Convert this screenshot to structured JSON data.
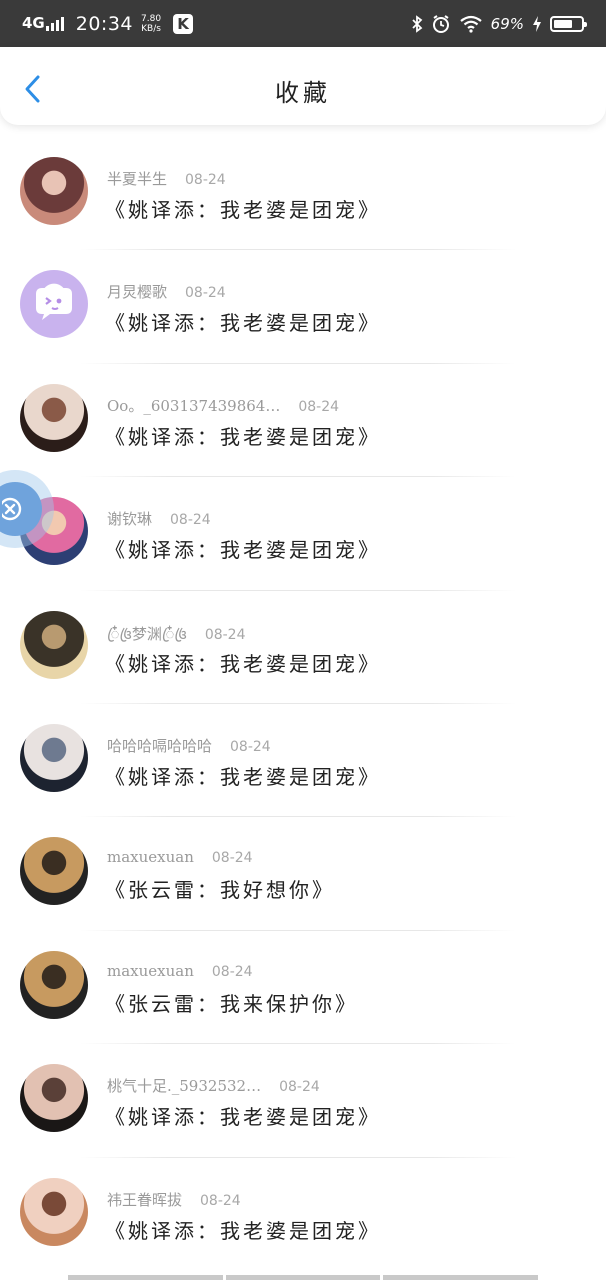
{
  "status": {
    "network": "4G",
    "time": "20:34",
    "speed_value": "7.80",
    "speed_unit": "KB/s",
    "app_badge": "K",
    "battery_text": "69%",
    "battery_level": 0.69
  },
  "header": {
    "title": "收藏",
    "back_icon": "chevron-left-icon"
  },
  "items": [
    {
      "name": "半夏半生",
      "date": "08-24",
      "title": "《姚译添：我老婆是团宠》",
      "avatar_colors": [
        "#c98a7a",
        "#6b3b3a",
        "#e8c3b5"
      ]
    },
    {
      "name": "月炅樱歌",
      "date": "08-24",
      "title": "《姚译添：我老婆是团宠》",
      "avatar_colors": [
        "#c9b3ee",
        "#c9b3ee",
        "#ffffff"
      ]
    },
    {
      "name": "Oo。_603137439864…",
      "date": "08-24",
      "title": "《姚译添：我老婆是团宠》",
      "avatar_colors": [
        "#2b1d19",
        "#e9d7cc",
        "#8a5a48"
      ]
    },
    {
      "name": "谢钦琳",
      "date": "08-24",
      "title": "《姚译添：我老婆是团宠》",
      "avatar_colors": [
        "#2d3f74",
        "#e16aa1",
        "#f2c9b0"
      ]
    },
    {
      "name": "ꦿ໋꧔ꦿ梦渊ꦿ໋꧔ꦿ",
      "date": "08-24",
      "title": "《姚译添：我老婆是团宠》",
      "avatar_colors": [
        "#e8d5a8",
        "#3a3328",
        "#b89a70"
      ]
    },
    {
      "name": "哈哈哈嗝哈哈哈",
      "date": "08-24",
      "title": "《姚译添：我老婆是团宠》",
      "avatar_colors": [
        "#1d2330",
        "#e8e2e0",
        "#6e7a90"
      ]
    },
    {
      "name": "maxuexuan",
      "date": "08-24",
      "title": "《张云雷：我好想你》",
      "avatar_colors": [
        "#222",
        "#c79a60",
        "#3a2e22"
      ]
    },
    {
      "name": "maxuexuan",
      "date": "08-24",
      "title": "《张云雷：我来保护你》",
      "avatar_colors": [
        "#222",
        "#c79a60",
        "#3a2e22"
      ]
    },
    {
      "name": "桃气十足._5932532…",
      "date": "08-24",
      "title": "《姚译添：我老婆是团宠》",
      "avatar_colors": [
        "#1a1716",
        "#e2c1b2",
        "#5a4038"
      ]
    },
    {
      "name": "祎王眷晖拔",
      "date": "08-24",
      "title": "《姚译添：我老婆是团宠》",
      "avatar_colors": [
        "#c98860",
        "#f0d0c0",
        "#7a4a38"
      ]
    }
  ],
  "colors": {
    "accent": "#2d8ee6",
    "status_bg": "#3a3a3a"
  }
}
